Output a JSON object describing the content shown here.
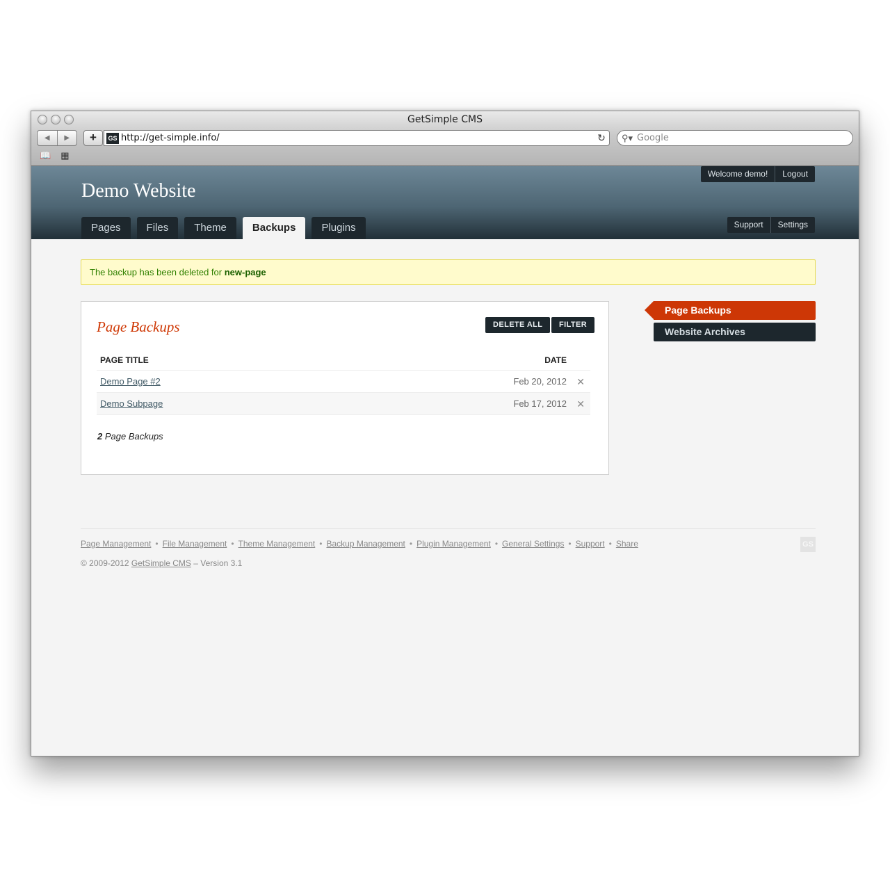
{
  "browser": {
    "window_title": "GetSimple CMS",
    "nav_back_icon": "◀",
    "nav_forward_icon": "▶",
    "add_icon": "+",
    "favicon_text": "GS",
    "url": "http://get-simple.info/",
    "reload_icon": "↻",
    "search_icon": "⚲▾",
    "search_placeholder": "Google",
    "bookmarks_icon": "📖",
    "top_sites_icon": "▦"
  },
  "header": {
    "site_title": "Demo Website",
    "welcome": "Welcome demo!",
    "logout": "Logout",
    "support": "Support",
    "settings": "Settings",
    "tabs": [
      {
        "label": "Pages"
      },
      {
        "label": "Files"
      },
      {
        "label": "Theme"
      },
      {
        "label": "Backups",
        "active": true
      },
      {
        "label": "Plugins"
      }
    ]
  },
  "notice": {
    "text": "The backup has been deleted for ",
    "page": "new-page"
  },
  "panel": {
    "title": "Page Backups",
    "delete_all": "DELETE ALL",
    "filter": "FILTER",
    "col_title": "PAGE TITLE",
    "col_date": "DATE",
    "rows": [
      {
        "title": "Demo Page #2",
        "date": "Feb 20, 2012"
      },
      {
        "title": "Demo Subpage",
        "date": "Feb 17, 2012"
      }
    ],
    "delete_icon": "✕",
    "count": "2",
    "count_label": " Page Backups"
  },
  "sidebar": {
    "items": [
      {
        "label": "Page Backups",
        "active": true
      },
      {
        "label": "Website Archives"
      }
    ]
  },
  "footer": {
    "links": [
      "Page Management",
      "File Management",
      "Theme Management",
      "Backup Management",
      "Plugin Management",
      "General Settings",
      "Support",
      "Share"
    ],
    "separator": "•",
    "copyright": "© 2009-2012 ",
    "cms_link": "GetSimple CMS",
    "version": " – Version 3.1",
    "logo_text": "GS"
  },
  "colors": {
    "accent": "#cd3706",
    "dark": "#1d272d",
    "notice_bg": "#fffbcc",
    "notice_text": "#308000"
  }
}
